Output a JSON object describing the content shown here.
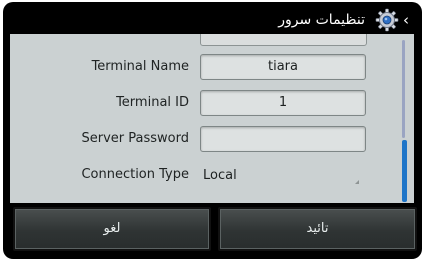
{
  "header": {
    "title": "تنظیمات سرور",
    "back_icon": "chevron-left-icon",
    "settings_icon": "gear-icon"
  },
  "form": {
    "terminal_name": {
      "label": "Terminal Name",
      "value": "tiara"
    },
    "terminal_id": {
      "label": "Terminal ID",
      "value": "1"
    },
    "server_password": {
      "label": "Server Password",
      "value": ""
    },
    "connection_type": {
      "label": "Connection Type",
      "value": "Local"
    }
  },
  "footer": {
    "cancel_label": "لغو",
    "ok_label": "تائید"
  },
  "colors": {
    "background": "#000000",
    "panel": "#cbd1d2",
    "field": "#dde1e1",
    "scroll_accent": "#1e75c8",
    "button": "#2f3434"
  }
}
